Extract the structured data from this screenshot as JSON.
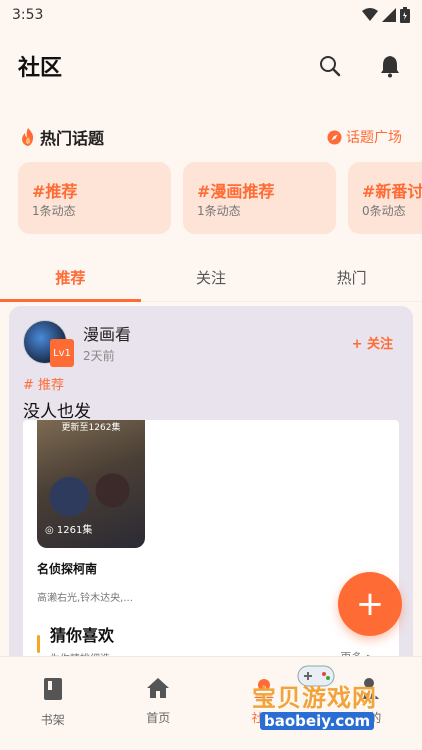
{
  "status": {
    "time": "3:53"
  },
  "header": {
    "title": "社区"
  },
  "hot_topics": {
    "title": "热门话题",
    "plaza_label": "话题广场",
    "items": [
      {
        "name": "#推荐",
        "count": "1条动态"
      },
      {
        "name": "#漫画推荐",
        "count": "1条动态"
      },
      {
        "name": "#新番讨论",
        "count": "0条动态"
      }
    ]
  },
  "tabs": [
    {
      "label": "推荐"
    },
    {
      "label": "关注"
    },
    {
      "label": "热门"
    }
  ],
  "post": {
    "user_name": "漫画看",
    "level": "Lv1",
    "time": "2天前",
    "follow_label": "+ 关注",
    "tag": "# 推荐",
    "text": "没人也发",
    "embed": {
      "cover_top": "更新至1262集",
      "cover_count": "◎ 1261集",
      "title": "名侦探柯南",
      "authors": "高濑右光,铃木达央,...",
      "guess_title": "猜你喜欢",
      "guess_sub": "为你精挑细选",
      "more": "更多 >"
    }
  },
  "fab": {
    "label": "+"
  },
  "bottom_nav": [
    {
      "label": "书架"
    },
    {
      "label": "首页"
    },
    {
      "label": "社区"
    },
    {
      "label": "我的"
    }
  ],
  "watermark": {
    "text": "宝贝游戏网",
    "url": "baobeiy.com"
  },
  "colors": {
    "accent": "#ff6b35",
    "background": "#fdf6f1",
    "topic_card": "#fde4d6"
  }
}
